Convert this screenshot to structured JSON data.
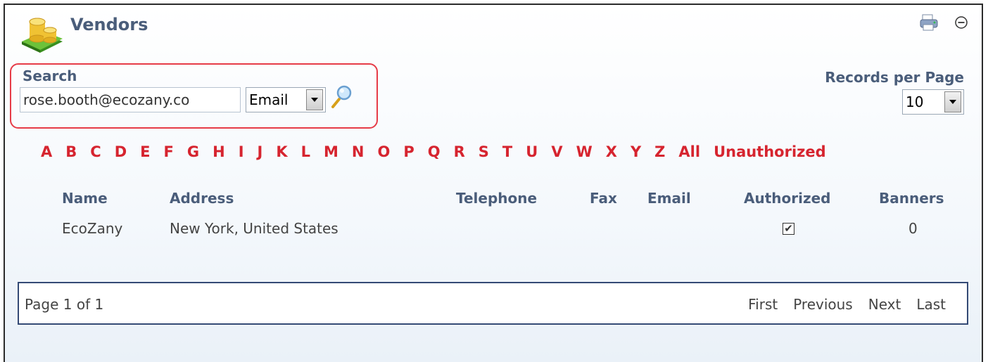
{
  "header": {
    "title": "Vendors",
    "icons": [
      "coins-stack-icon",
      "print-icon",
      "collapse-icon"
    ]
  },
  "search": {
    "label": "Search",
    "value": "rose.booth@ecozany.co",
    "field_type": "Email",
    "go_icon": "magnifier-icon"
  },
  "records_per_page": {
    "label": "Records per Page",
    "value": "10"
  },
  "alphabet": [
    "A",
    "B",
    "C",
    "D",
    "E",
    "F",
    "G",
    "H",
    "I",
    "J",
    "K",
    "L",
    "M",
    "N",
    "O",
    "P",
    "Q",
    "R",
    "S",
    "T",
    "U",
    "V",
    "W",
    "X",
    "Y",
    "Z",
    "All",
    "Unauthorized"
  ],
  "table": {
    "columns": [
      "Name",
      "Address",
      "Telephone",
      "Fax",
      "Email",
      "Authorized",
      "Banners"
    ],
    "rows": [
      {
        "name": "EcoZany",
        "address": "New York, United States",
        "telephone": "",
        "fax": "",
        "email": "",
        "authorized": true,
        "authorized_mark": "✔",
        "banners": "0"
      }
    ]
  },
  "pager": {
    "info": "Page 1 of 1",
    "links": [
      "First",
      "Previous",
      "Next",
      "Last"
    ]
  },
  "colors": {
    "accent_red": "#d6242f",
    "heading_blue": "#4a5d7a",
    "highlight_border": "#e63b47",
    "pager_border": "#344a75"
  }
}
